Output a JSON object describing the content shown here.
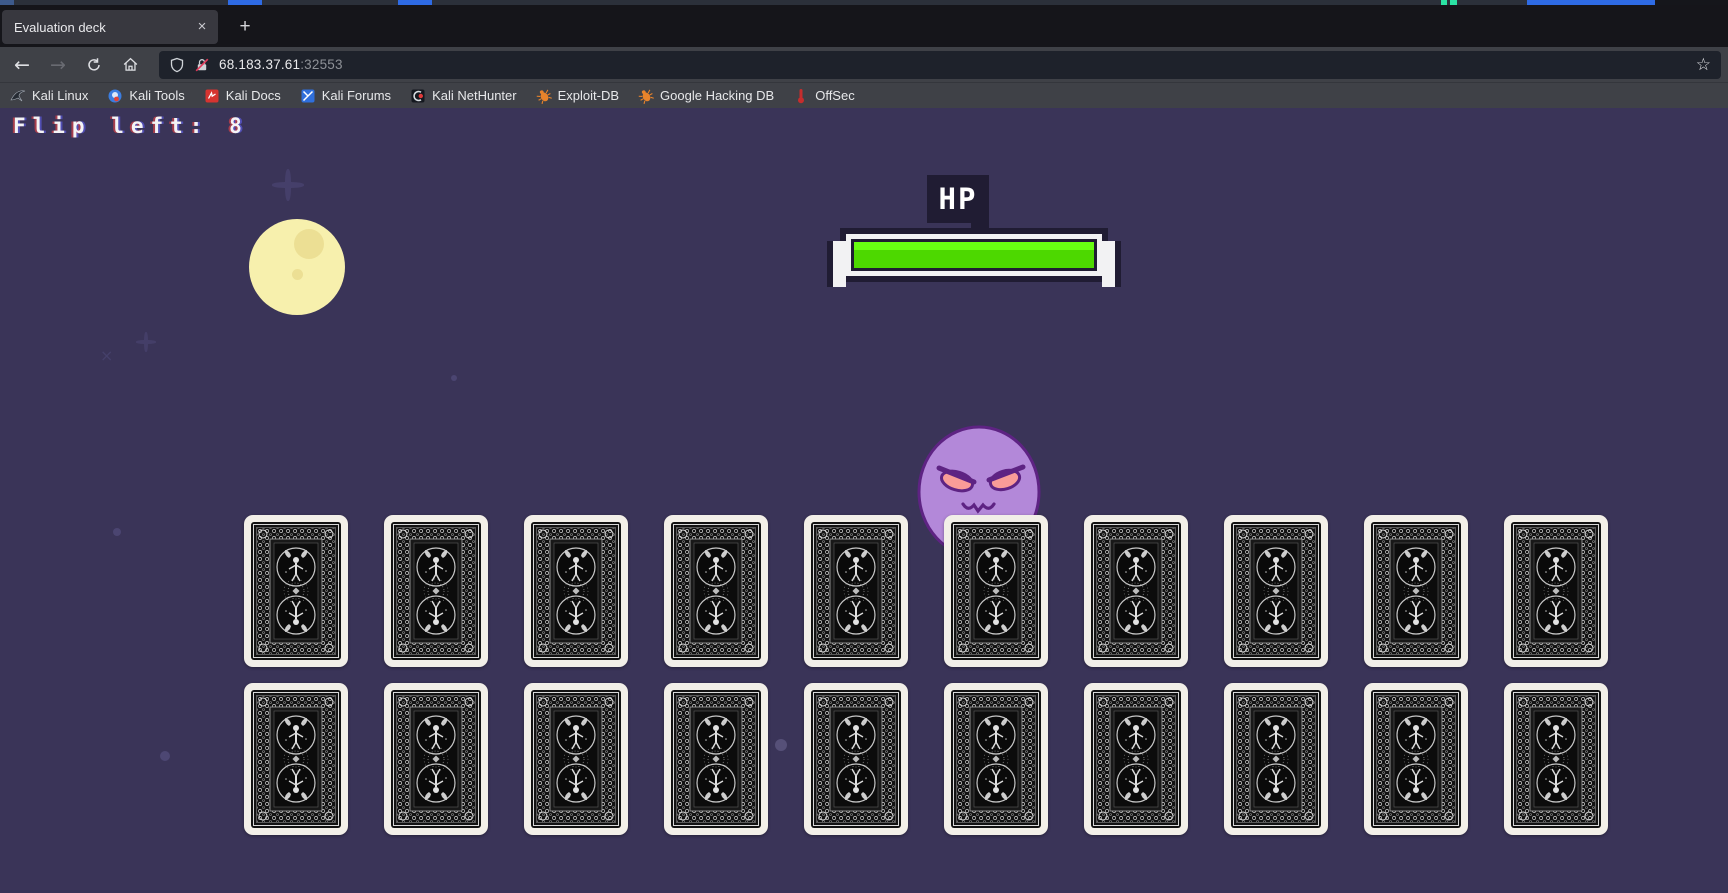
{
  "taskbar": {
    "accent_blue": "#2e6be5",
    "accent_teal": "#2be3a4"
  },
  "browser": {
    "tab_title": "Evaluation deck",
    "tab_close": "×",
    "new_tab": "+",
    "nav": {
      "back": "←",
      "forward": "→"
    },
    "url_host": "68.183.37.61",
    "url_port": ":32553",
    "star": "☆",
    "bookmarks": [
      {
        "label": "Kali Linux"
      },
      {
        "label": "Kali Tools"
      },
      {
        "label": "Kali Docs"
      },
      {
        "label": "Kali Forums"
      },
      {
        "label": "Kali NetHunter"
      },
      {
        "label": "Exploit-DB"
      },
      {
        "label": "Google Hacking DB"
      },
      {
        "label": "OffSec"
      }
    ]
  },
  "game": {
    "flip_label": "Flip left: 8",
    "hp_label": "HP",
    "hp_percent": 100,
    "cards": {
      "per_row": [
        10,
        10
      ],
      "total": 20,
      "state": "face-down"
    },
    "colors": {
      "background": "#3a3458",
      "hp_green": "#4dd800",
      "ghost_purple": "#b388d9",
      "moon_yellow": "#f7f0ad",
      "card_back": "#121212"
    }
  }
}
